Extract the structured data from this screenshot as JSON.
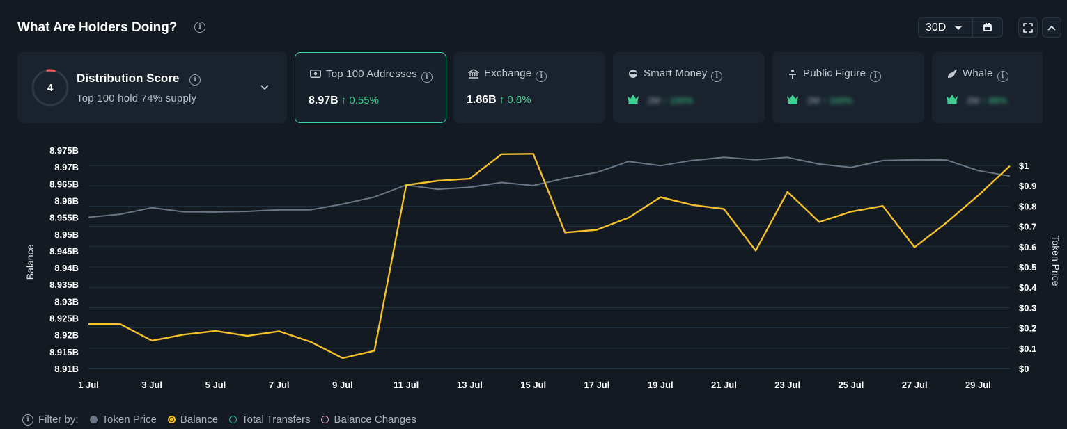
{
  "header": {
    "title": "What Are Holders Doing?",
    "range": "30D"
  },
  "distribution": {
    "score": "4",
    "title": "Distribution Score",
    "subtitle": "Top 100 hold 74% supply"
  },
  "cards": [
    {
      "label": "Top 100 Addresses",
      "value": "8.97B",
      "change": "↑ 0.55%",
      "icon": "wallet-icon"
    },
    {
      "label": "Exchange",
      "value": "1.86B",
      "change": "↑ 0.8%",
      "icon": "bank-icon"
    },
    {
      "label": "Smart Money",
      "value": "2M",
      "change": "↑ 100%",
      "icon": "smart-money-icon",
      "locked": true
    },
    {
      "label": "Public Figure",
      "value": "2M",
      "change": "↑ 100%",
      "icon": "public-figure-icon",
      "locked": true
    },
    {
      "label": "Whale",
      "value": "2M",
      "change": "↑ 86%",
      "icon": "whale-icon",
      "locked": true
    }
  ],
  "filters": {
    "label": "Filter by:",
    "items": [
      {
        "label": "Token Price",
        "color": "#6b7785",
        "style": "filled"
      },
      {
        "label": "Balance",
        "color": "#f4c12a",
        "style": "ring-filled"
      },
      {
        "label": "Total Transfers",
        "color": "#2bb5a8",
        "style": "ring"
      },
      {
        "label": "Balance Changes",
        "color": "#e9a3c6",
        "style": "ring"
      }
    ]
  },
  "chart_data": {
    "type": "line",
    "x": [
      "1 Jul",
      "2 Jul",
      "3 Jul",
      "4 Jul",
      "5 Jul",
      "6 Jul",
      "7 Jul",
      "8 Jul",
      "9 Jul",
      "10 Jul",
      "11 Jul",
      "12 Jul",
      "13 Jul",
      "14 Jul",
      "15 Jul",
      "16 Jul",
      "17 Jul",
      "18 Jul",
      "19 Jul",
      "20 Jul",
      "21 Jul",
      "22 Jul",
      "23 Jul",
      "24 Jul",
      "25 Jul",
      "26 Jul",
      "27 Jul",
      "28 Jul",
      "29 Jul",
      "30 Jul"
    ],
    "x_tick_labels": [
      "1 Jul",
      "3 Jul",
      "5 Jul",
      "7 Jul",
      "9 Jul",
      "11 Jul",
      "13 Jul",
      "15 Jul",
      "17 Jul",
      "19 Jul",
      "21 Jul",
      "23 Jul",
      "25 Jul",
      "27 Jul",
      "29 Jul"
    ],
    "y_left": {
      "label": "Balance",
      "ticks": [
        "8.91B",
        "8.915B",
        "8.92B",
        "8.925B",
        "8.93B",
        "8.935B",
        "8.94B",
        "8.945B",
        "8.95B",
        "8.955B",
        "8.96B",
        "8.965B",
        "8.97B",
        "8.975B"
      ],
      "range": [
        8.91,
        8.975
      ]
    },
    "y_right": {
      "label": "Token Price",
      "ticks": [
        "$0",
        "$0.1",
        "$0.2",
        "$0.3",
        "$0.4",
        "$0.5",
        "$0.6",
        "$0.7",
        "$0.8",
        "$0.9",
        "$1"
      ],
      "range": [
        0,
        1.0
      ]
    },
    "series": [
      {
        "name": "Token Price",
        "color": "#6b7785",
        "axis": "right",
        "values": [
          0.745,
          0.76,
          0.792,
          0.772,
          0.771,
          0.774,
          0.782,
          0.782,
          0.81,
          0.845,
          0.904,
          0.883,
          0.893,
          0.916,
          0.901,
          0.937,
          0.966,
          1.02,
          0.999,
          1.025,
          1.04,
          1.028,
          1.04,
          1.007,
          0.99,
          1.024,
          1.028,
          1.027,
          0.975,
          0.948
        ]
      },
      {
        "name": "Balance",
        "color": "#f4c12a",
        "axis": "left",
        "values": [
          8.9232,
          8.9232,
          8.9183,
          8.9201,
          8.9212,
          8.9197,
          8.9211,
          8.9179,
          8.9131,
          8.9153,
          8.9646,
          8.9659,
          8.9665,
          8.9738,
          8.9739,
          8.9505,
          8.9513,
          8.9549,
          8.961,
          8.9587,
          8.9575,
          8.9451,
          8.9626,
          8.9536,
          8.9567,
          8.9584,
          8.9461,
          8.9534,
          8.9615,
          8.9703
        ]
      }
    ],
    "grid": true
  }
}
